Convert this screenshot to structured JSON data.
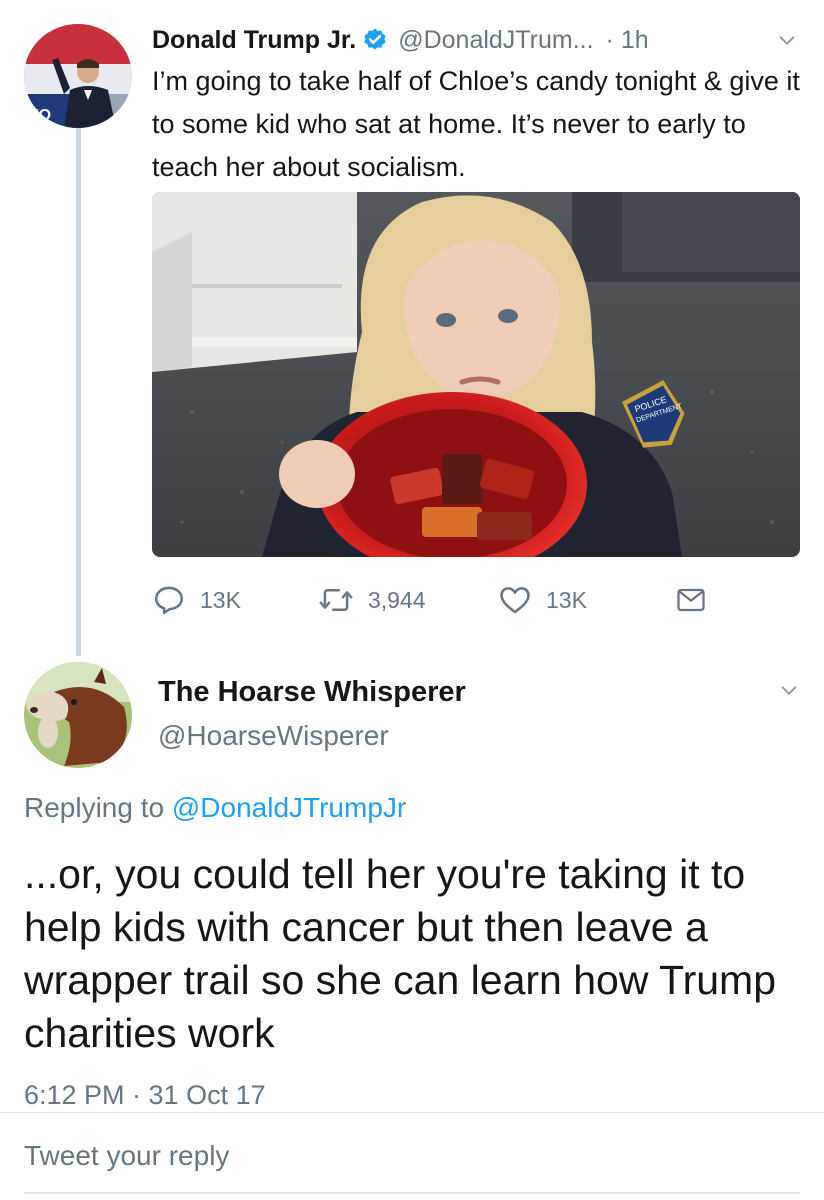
{
  "tweet": {
    "author_name": "Donald Trump Jr.",
    "author_handle": "@DonaldJTrum...",
    "time_ago": "· 1h",
    "text": "I’m going to take half of Chloe’s candy tonight & give it to some kid who sat at home. It’s never to early to teach her about socialism.",
    "photo_text": [
      "POLICE",
      "DEPARTMENT"
    ],
    "actions": {
      "replies": "13K",
      "retweets": "3,944",
      "likes": "13K"
    }
  },
  "reply": {
    "author_name": "The Hoarse Whisperer",
    "author_handle": "@HoarseWisperer",
    "replying_prefix": "Replying to",
    "replying_to": "@DonaldJTrumpJr",
    "text": "...or, you could tell her you're taking it to help kids with cancer but then leave a wrapper trail so she can learn how Trump charities work",
    "timestamp": "6:12 PM · 31 Oct 17"
  },
  "composer": {
    "placeholder": "Tweet your reply"
  },
  "colors": {
    "accent": "#1da1f2",
    "secondary_text": "#657786",
    "thread_line": "#cdd6dd"
  },
  "icons": [
    "verified-badge-icon",
    "chevron-down-icon",
    "reply-icon",
    "retweet-icon",
    "like-icon",
    "direct-message-icon"
  ]
}
